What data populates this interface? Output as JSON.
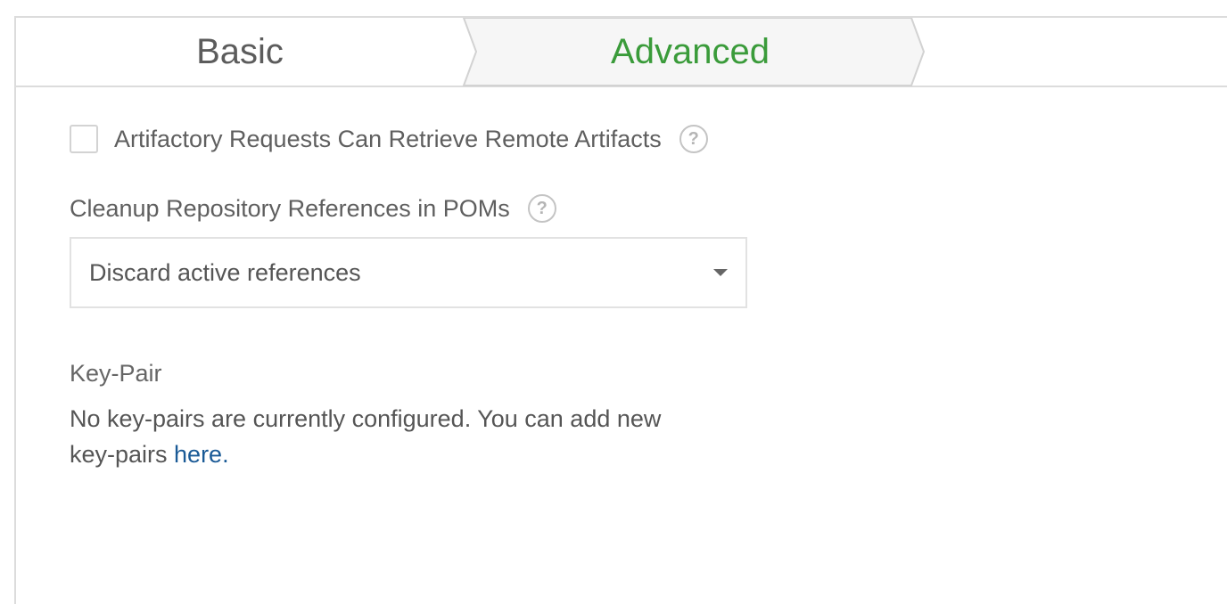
{
  "tabs": {
    "basic": "Basic",
    "advanced": "Advanced"
  },
  "options": {
    "remote_artifacts": {
      "label": "Artifactory Requests Can Retrieve Remote Artifacts",
      "checked": false,
      "help": "?"
    },
    "cleanup_refs": {
      "label": "Cleanup Repository References in POMs",
      "help": "?",
      "selected": "Discard active references"
    }
  },
  "key_pair": {
    "title": "Key-Pair",
    "message_line1": "No key-pairs are currently configured. You can add new",
    "message_line2_prefix": "key-pairs ",
    "link_text": "here."
  },
  "colors": {
    "active_tab": "#3a9b3a",
    "link": "#1a5a96"
  }
}
